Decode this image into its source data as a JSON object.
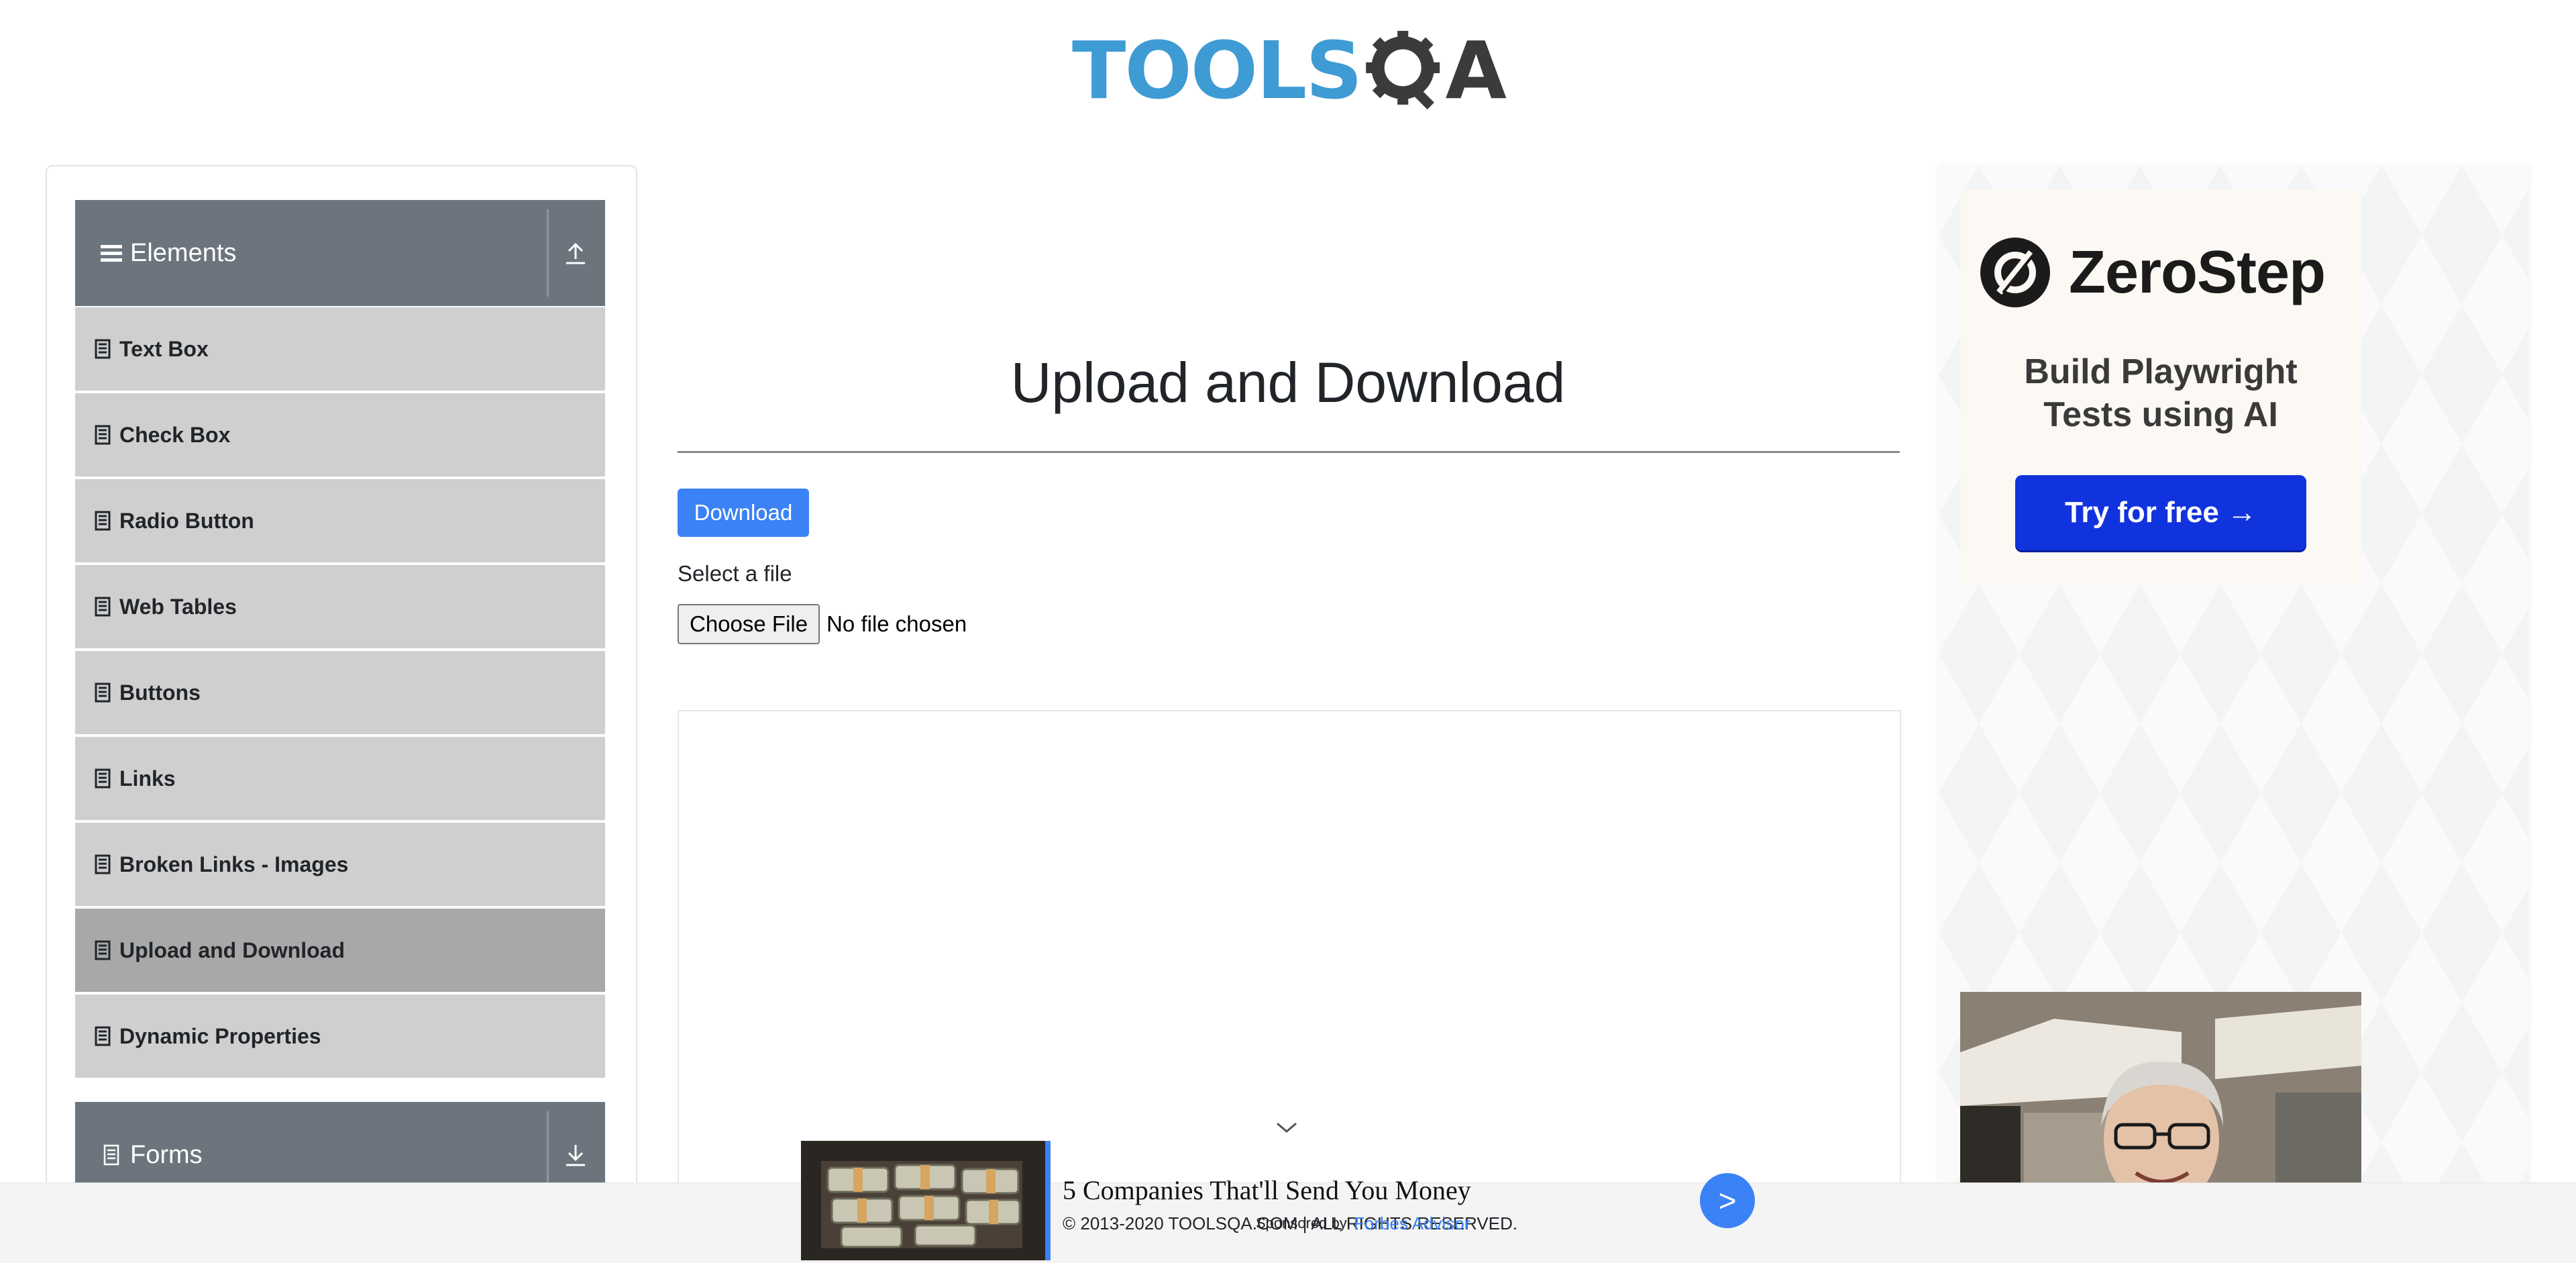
{
  "header": {
    "logo_text_primary": "TOOLS",
    "logo_text_secondary": "A",
    "logo_icon": "gear-magnifier-icon"
  },
  "sidebar": {
    "groups": [
      {
        "label": "Elements",
        "icon": "hamburger-icon",
        "toggle_icon": "collapse-up-icon",
        "items": [
          {
            "label": "Text Box"
          },
          {
            "label": "Check Box"
          },
          {
            "label": "Radio Button"
          },
          {
            "label": "Web Tables"
          },
          {
            "label": "Buttons"
          },
          {
            "label": "Links"
          },
          {
            "label": "Broken Links - Images"
          },
          {
            "label": "Upload and Download",
            "active": true
          },
          {
            "label": "Dynamic Properties"
          }
        ]
      },
      {
        "label": "Forms",
        "icon": "document-icon",
        "toggle_icon": "expand-down-icon"
      }
    ],
    "item_icon": "file-icon"
  },
  "main": {
    "title": "Upload and Download",
    "download_label": "Download",
    "select_label": "Select a file",
    "choose_file_label": "Choose File",
    "file_status": "No file chosen",
    "chevron_icon": "chevron-down-icon"
  },
  "ads": {
    "zerostep": {
      "brand": "ZeroStep",
      "tagline_line1": "Build Playwright",
      "tagline_line2": "Tests using AI",
      "cta": "Try for free →"
    },
    "bottom": {
      "headline": "5 Companies That'll Send You Money",
      "arrow": ">"
    }
  },
  "footer": {
    "copyright": "© 2013-2020 TOOLSQA.COM | ALL RIGHTS RESERVED.",
    "sponsored_label": "Sponsored by",
    "sponsor_link": "Forbes Advisor"
  },
  "colors": {
    "accent": "#3b82f6",
    "sidebar_header": "#6c757d",
    "menu_item": "#cfcfcf",
    "menu_item_active": "#a8a8a8",
    "zerostep_cta": "#1133dd",
    "logo_blue": "#3f9bd3"
  }
}
